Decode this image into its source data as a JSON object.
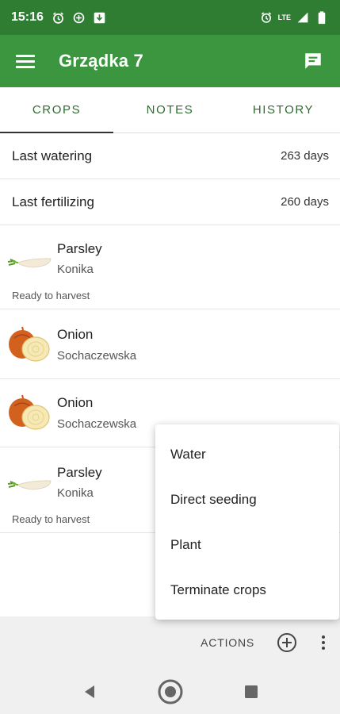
{
  "status_bar": {
    "time": "15:16",
    "network_label": "LTE"
  },
  "app_bar": {
    "title": "Grządka 7"
  },
  "tabs": [
    {
      "label": "CROPS",
      "active": true
    },
    {
      "label": "NOTES",
      "active": false
    },
    {
      "label": "HISTORY",
      "active": false
    }
  ],
  "watering": {
    "label": "Last watering",
    "value": "263 days"
  },
  "fertilizing": {
    "label": "Last fertilizing",
    "value": "260 days"
  },
  "crops": [
    {
      "name": "Parsley",
      "variety": "Konika",
      "status": "Ready to harvest",
      "icon": "parsley-icon"
    },
    {
      "name": "Onion",
      "variety": "Sochaczewska",
      "status": "",
      "icon": "onion-icon"
    },
    {
      "name": "Onion",
      "variety": "Sochaczewska",
      "status": "",
      "icon": "onion-icon"
    },
    {
      "name": "Parsley",
      "variety": "Konika",
      "status": "Ready to harvest",
      "icon": "parsley-icon"
    }
  ],
  "popup_menu": {
    "items": [
      "Water",
      "Direct seeding",
      "Plant",
      "Terminate crops"
    ]
  },
  "bottom_bar": {
    "actions_label": "ACTIONS"
  },
  "colors": {
    "status_bar": "#2f7d32",
    "app_bar": "#3c9640",
    "tab_text": "#2f6a32"
  }
}
